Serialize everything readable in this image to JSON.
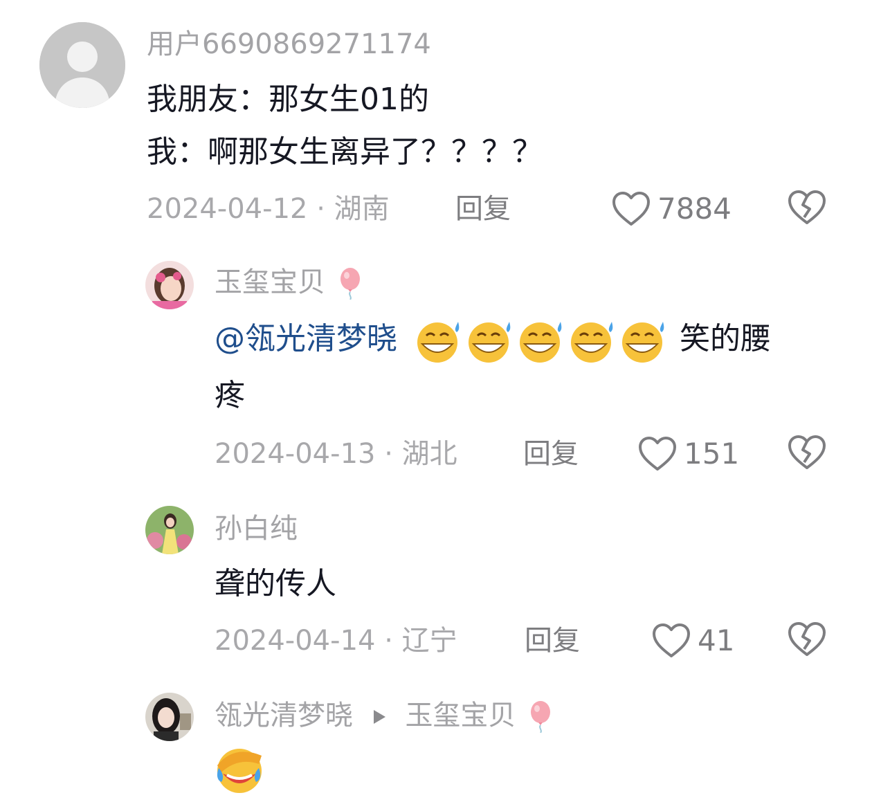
{
  "comments": [
    {
      "username": "用户6690869271174",
      "text_line1": "我朋友：那女生01的",
      "text_line2": "我：啊那女生离异了？？？？",
      "date": "2024-04-12",
      "region": "湖南",
      "reply_label": "回复",
      "likes": "7884"
    },
    {
      "username": "玉玺宝贝",
      "mention": "@瓴光清梦晓",
      "text_after_emoji": "笑的腰",
      "text_line2": "疼",
      "emoji_name": "sweat-grin-emoji",
      "emoji_count": 5,
      "date": "2024-04-13",
      "region": "湖北",
      "reply_label": "回复",
      "likes": "151"
    },
    {
      "username": "孙白纯",
      "text_line1": "聋的传人",
      "date": "2024-04-14",
      "region": "辽宁",
      "reply_label": "回复",
      "likes": "41"
    },
    {
      "username": "瓴光清梦晓",
      "reply_to": "玉玺宝贝",
      "emoji_name": "facepalm-laugh-emoji"
    }
  ],
  "colors": {
    "mention": "#1f4e8c",
    "meta": "#a8a8ab",
    "text": "#161823",
    "icon": "#7d7d80"
  },
  "icons": {
    "like": "heart-outline-icon",
    "dislike": "broken-heart-icon",
    "reply_arrow": "play-triangle-icon",
    "balloon": "pink-balloon-icon"
  }
}
